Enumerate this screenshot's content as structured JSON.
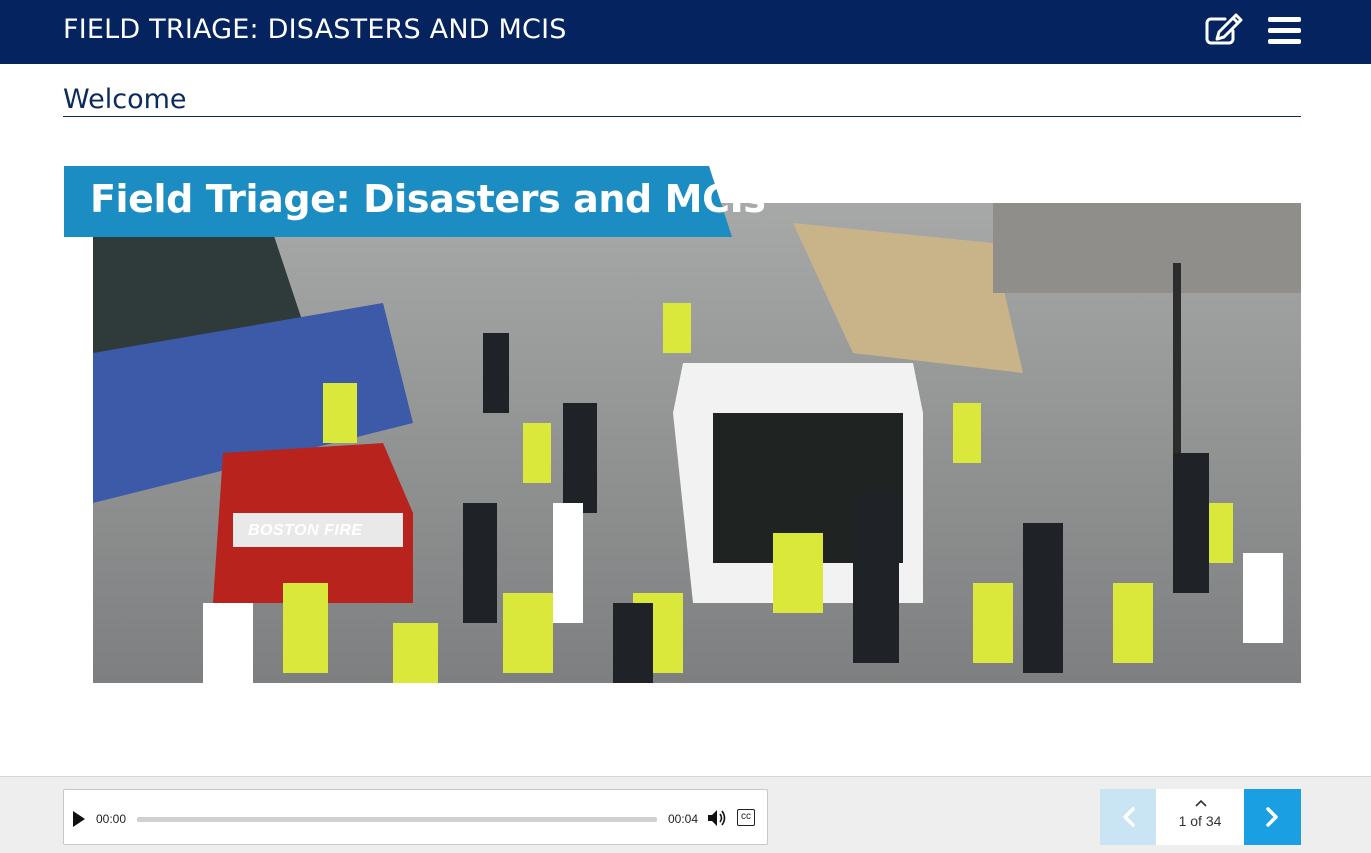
{
  "header": {
    "title": "FIELD TRIAGE: DISASTERS AND MCIS",
    "edit_icon": "edit-note-icon",
    "menu_icon": "hamburger-menu-icon",
    "background_color": "#04235f"
  },
  "page": {
    "heading": "Welcome"
  },
  "banner": {
    "title": "Field Triage: Disasters and MCIs",
    "tab_color": "#1c8dc3",
    "photo_sign_text": "BOSTON FIRE"
  },
  "player": {
    "play_icon": "play-icon",
    "current_time": "00:00",
    "duration": "00:04",
    "progress_fraction": 0.0,
    "volume_icon": "volume-icon",
    "cc_label": "cc"
  },
  "navigation": {
    "prev_icon": "chevron-left-icon",
    "next_icon": "chevron-right-icon",
    "expand_icon": "chevron-up-icon",
    "page_indicator": "1 of 34",
    "accent_color": "#1aa0e2"
  }
}
